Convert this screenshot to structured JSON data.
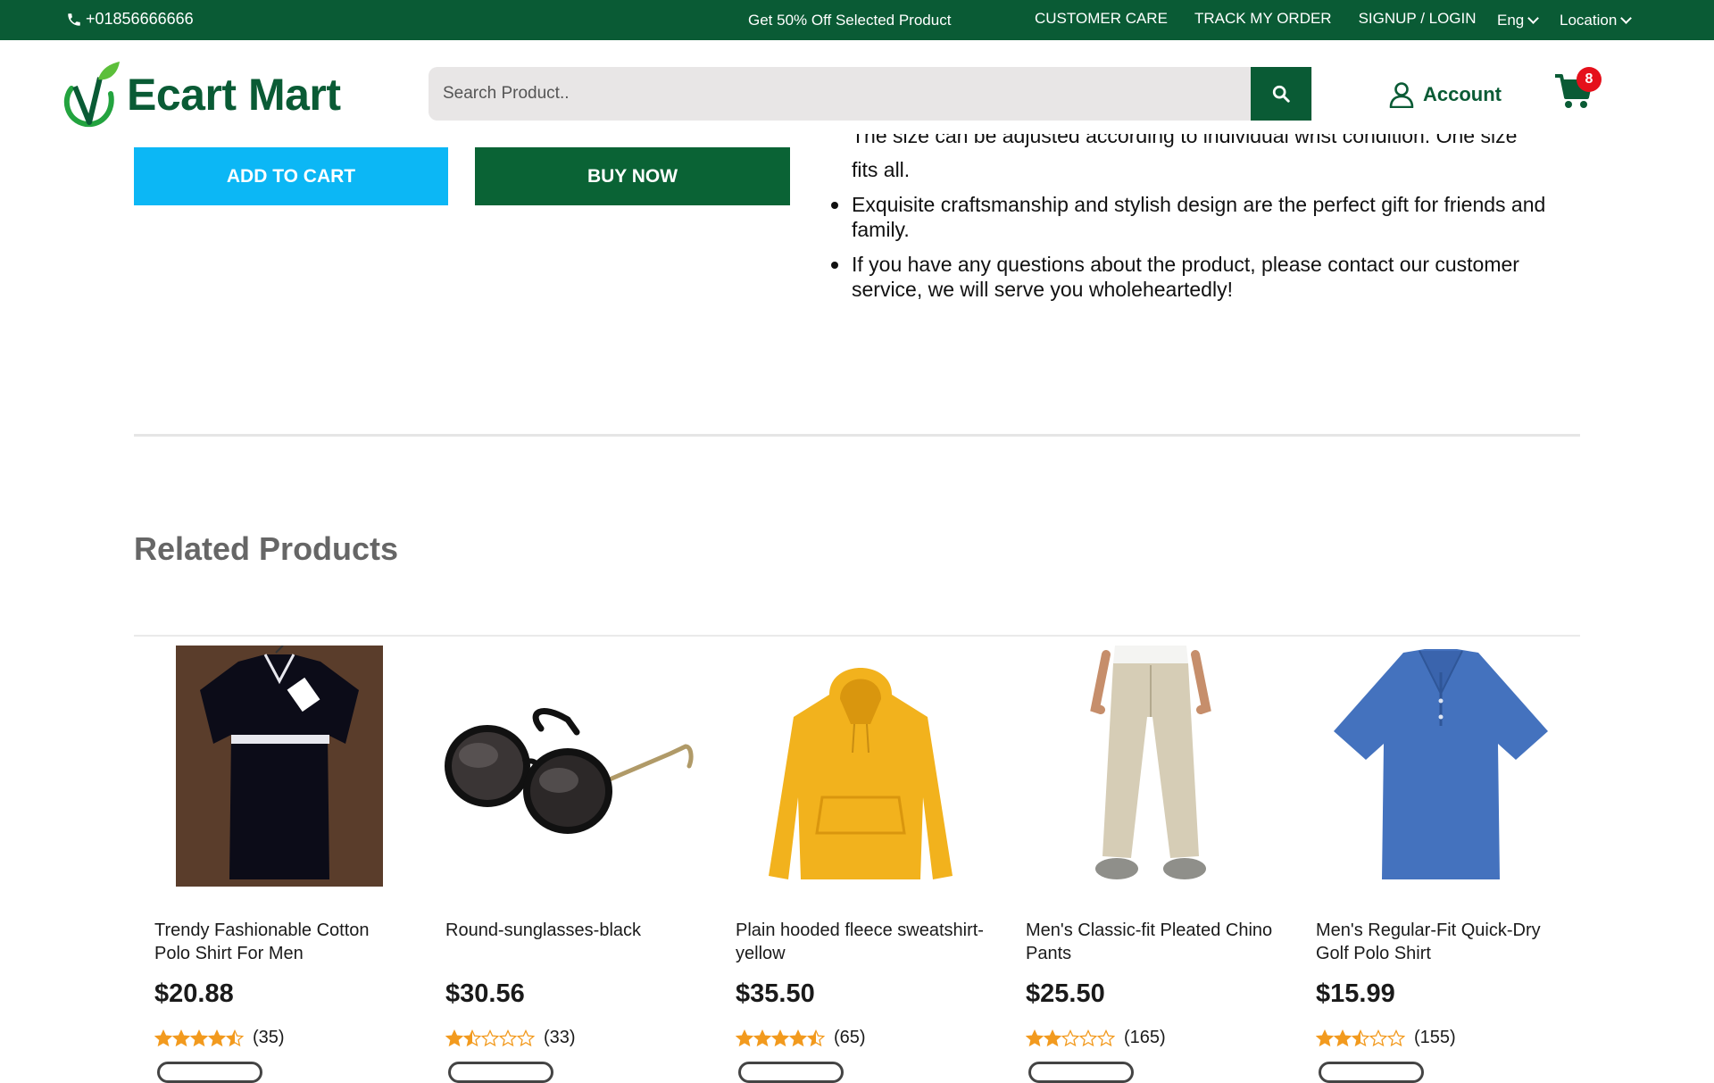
{
  "topbar": {
    "phone": "+01856666666",
    "promo": "Get 50% Off Selected Product",
    "links": [
      "CUSTOMER CARE",
      "TRACK MY ORDER",
      "SIGNUP / LOGIN"
    ],
    "language": "Eng",
    "location": "Location"
  },
  "header": {
    "logo_text": "Ecart Mart",
    "search_placeholder": "Search Product..",
    "account_label": "Account",
    "cart_count": "8"
  },
  "colors": {
    "brand_green": "#0a5b35",
    "add_to_cart_blue": "#0cb7f5",
    "badge_red": "#e5101b",
    "star_orange": "#f29a1e"
  },
  "actions": {
    "add_to_cart": "ADD TO CART",
    "buy_now": "BUY NOW"
  },
  "description": {
    "cut_line": "The size can be adjusted according to individual wrist condition. One size",
    "items": [
      "fits all.",
      "Exquisite craftsmanship and stylish design are the perfect gift for friends and family.",
      "If you have any questions about the product, please contact our customer service, we will serve you wholeheartedly!"
    ]
  },
  "related": {
    "title": "Related Products",
    "products": [
      {
        "name": "Trendy Fashionable Cotton Polo Shirt For Men",
        "price": "$20.88",
        "rating": 4.5,
        "reviews": "(35)",
        "image_icon": "black-polo-shirt-image"
      },
      {
        "name": "Round-sunglasses-black",
        "price": "$30.56",
        "rating": 1.5,
        "reviews": "(33)",
        "image_icon": "sunglasses-image"
      },
      {
        "name": "Plain hooded fleece sweatshirt-yellow",
        "price": "$35.50",
        "rating": 4.5,
        "reviews": "(65)",
        "image_icon": "yellow-hoodie-image"
      },
      {
        "name": "Men's Classic-fit Pleated Chino Pants",
        "price": "$25.50",
        "rating": 2,
        "reviews": "(165)",
        "image_icon": "chino-pants-image"
      },
      {
        "name": "Men's Regular-Fit Quick-Dry Golf Polo Shirt",
        "price": "$15.99",
        "rating": 2.5,
        "reviews": "(155)",
        "image_icon": "blue-polo-shirt-image"
      }
    ]
  }
}
